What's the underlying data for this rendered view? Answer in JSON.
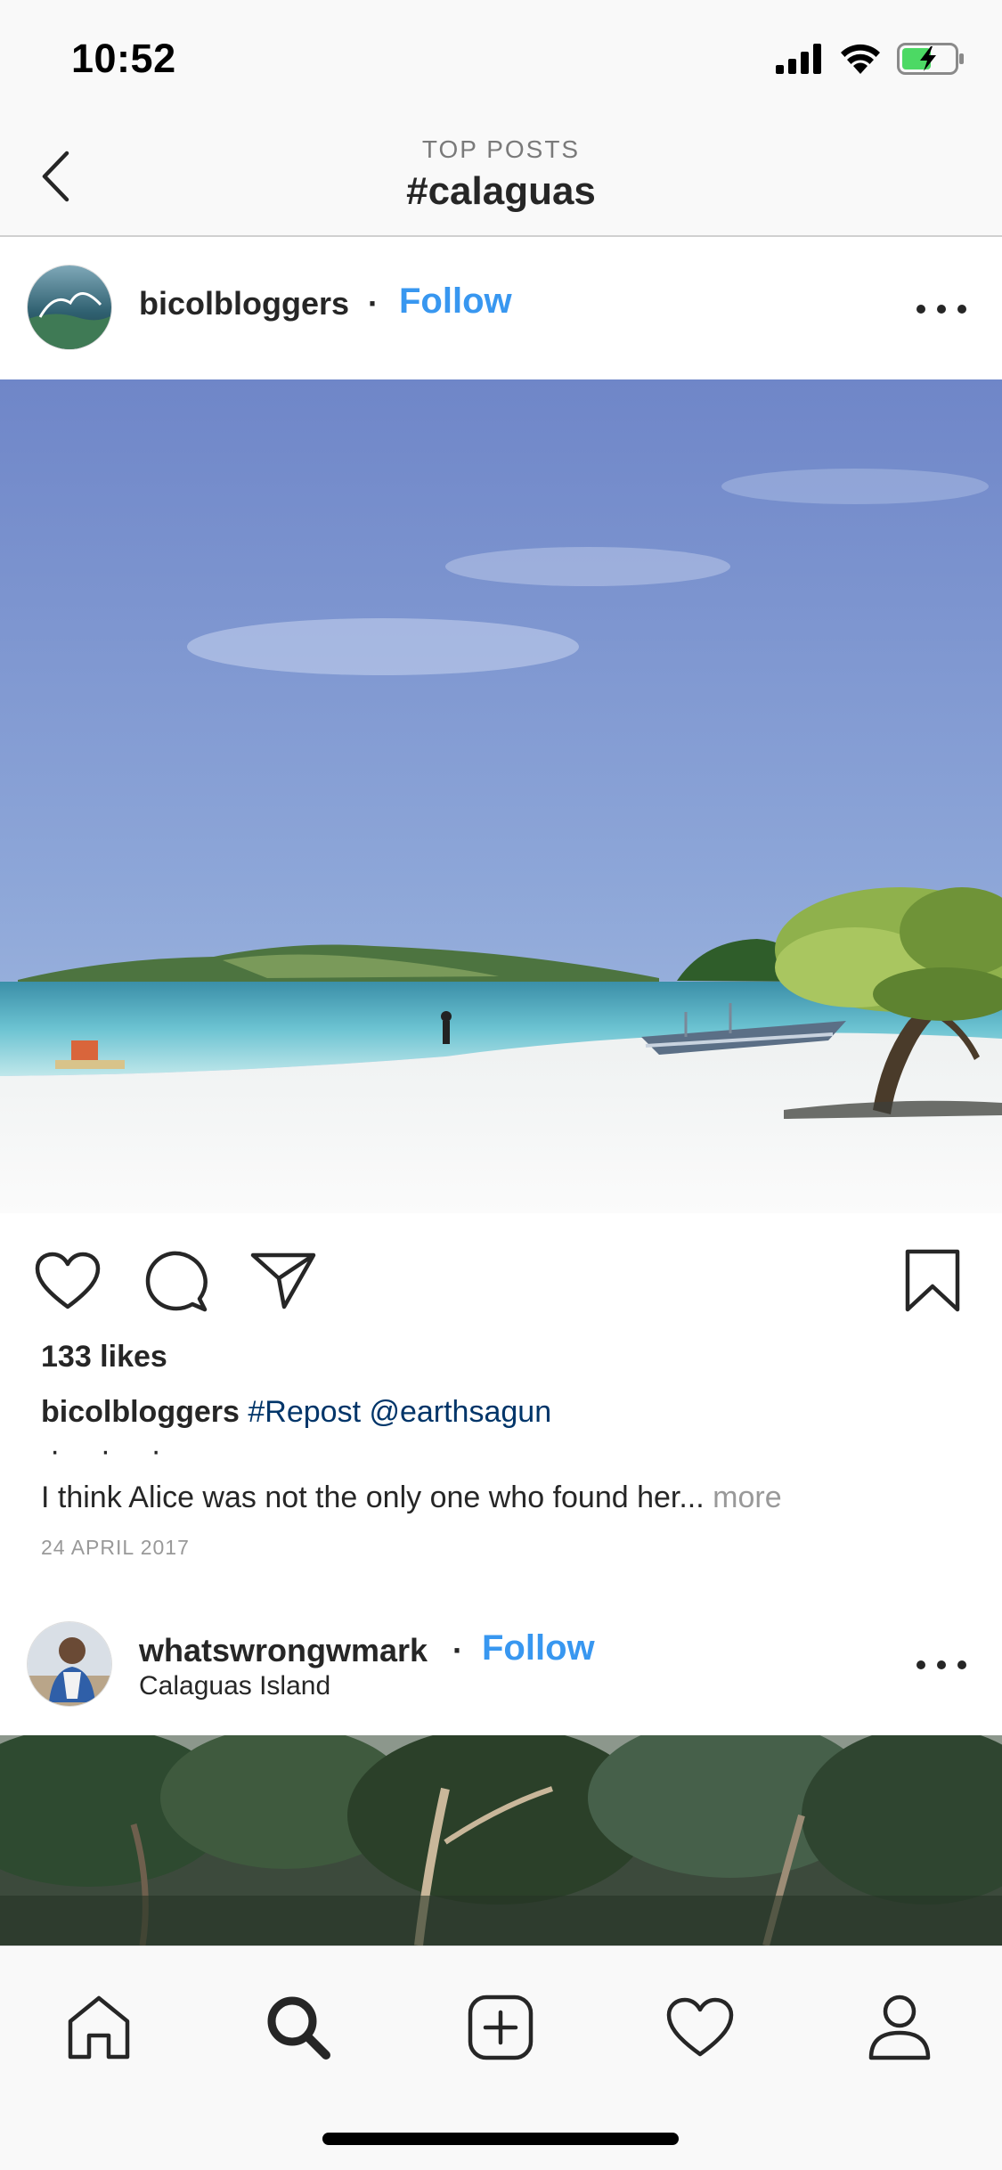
{
  "status": {
    "time": "10:52"
  },
  "header": {
    "subtitle": "TOP POSTS",
    "title": "#calaguas"
  },
  "posts": [
    {
      "username": "bicolbloggers",
      "follow_label": "Follow",
      "likes": "133 likes",
      "caption_user": "bicolbloggers",
      "caption_tags": "#Repost @earthsagun",
      "caption_dots": "· · ·",
      "caption_text": "I think Alice was not the only one who found her...",
      "more_label": "more",
      "date": "24 APRIL 2017"
    },
    {
      "username": "whatswrongwmark",
      "follow_label": "Follow",
      "location": "Calaguas Island"
    }
  ],
  "tabs": [
    {
      "name": "home",
      "icon": "home-icon"
    },
    {
      "name": "search",
      "icon": "search-icon",
      "active": true
    },
    {
      "name": "new-post",
      "icon": "plus-square-icon"
    },
    {
      "name": "activity",
      "icon": "heart-icon"
    },
    {
      "name": "profile",
      "icon": "profile-icon"
    }
  ],
  "colors": {
    "follow": "#3897f0",
    "tag": "#003569",
    "muted": "#999999",
    "battery": "#4cd964"
  }
}
